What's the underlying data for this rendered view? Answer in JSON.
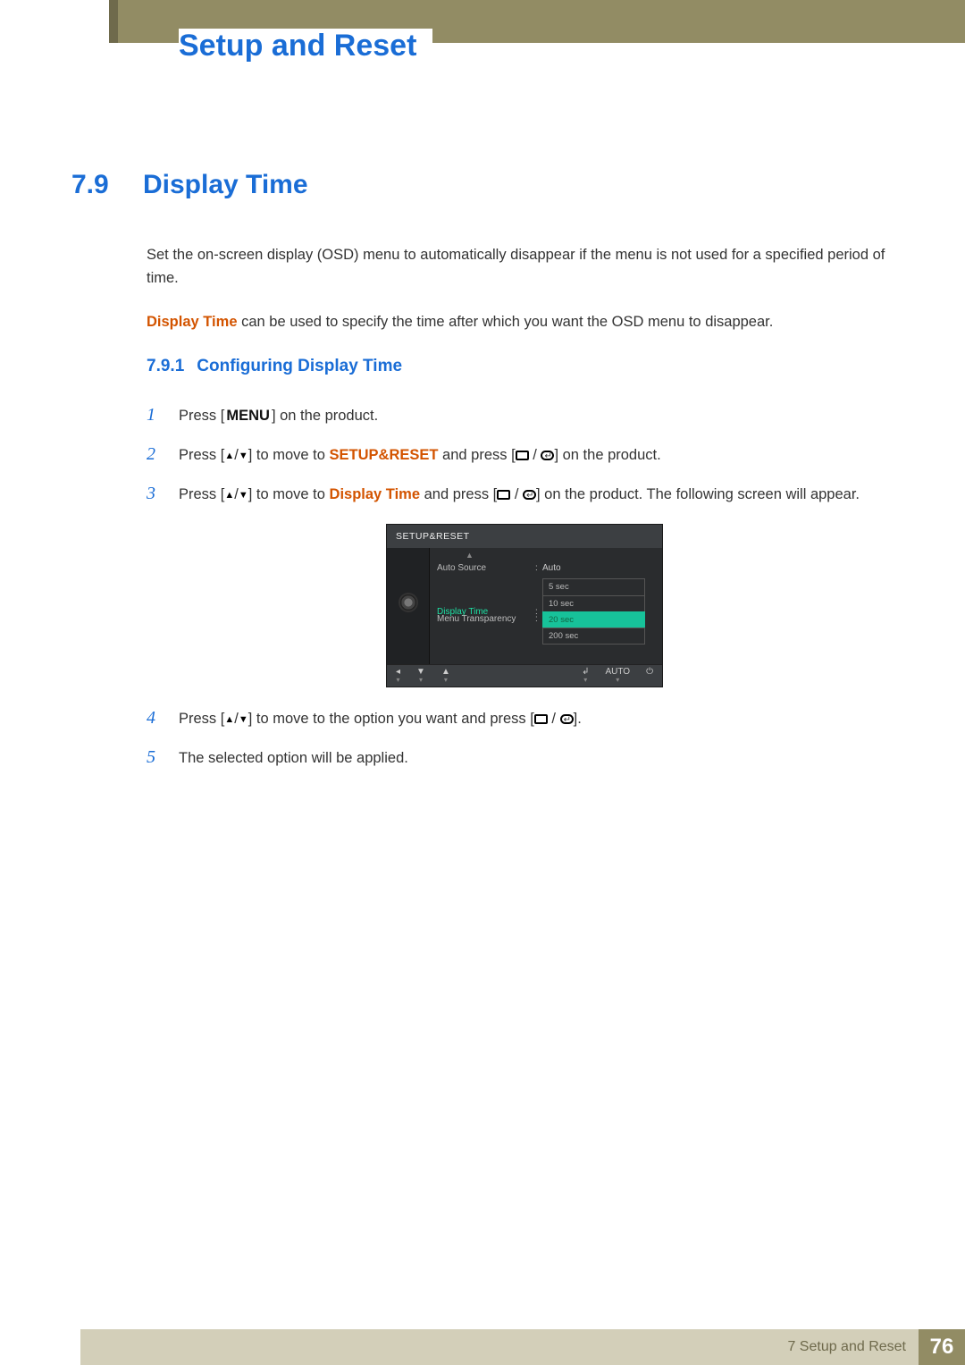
{
  "chapter_title": "Setup and Reset",
  "section": {
    "num": "7.9",
    "title": "Display Time"
  },
  "intro": "Set the on-screen display (OSD) menu to automatically disappear if the menu is not used for a specified period of time.",
  "hint": {
    "bold": "Display Time",
    "rest": " can be used to specify the time after which you want the OSD menu to disappear."
  },
  "subsection": {
    "num": "7.9.1",
    "title": "Configuring Display Time"
  },
  "steps": {
    "s1": {
      "a": "Press [",
      "menu": "MENU",
      "b": "] on the product."
    },
    "s2": {
      "a": "Press [",
      "b": "] to move to ",
      "target": "SETUP&RESET",
      "c": " and press [",
      "d": "] on the product."
    },
    "s3": {
      "a": "Press [",
      "b": "] to move to ",
      "target": "Display Time",
      "c": " and press [",
      "d": "] on the product. The following screen will appear."
    },
    "s4": {
      "a": "Press [",
      "b": "] to move to the option you want and press [",
      "c": "]."
    },
    "s5": "The selected option will be applied."
  },
  "osd": {
    "title": "SETUP&RESET",
    "rows": {
      "auto_source": {
        "label": "Auto Source",
        "value": "Auto"
      },
      "display_time": {
        "label": "Display Time"
      },
      "menu_trans": {
        "label": "Menu Transparency"
      }
    },
    "options": [
      "5 sec",
      "10 sec",
      "20 sec",
      "200 sec"
    ],
    "selected_index": 2,
    "bottom": {
      "auto": "AUTO"
    }
  },
  "footer": {
    "label": "7 Setup and Reset",
    "page": "76"
  }
}
